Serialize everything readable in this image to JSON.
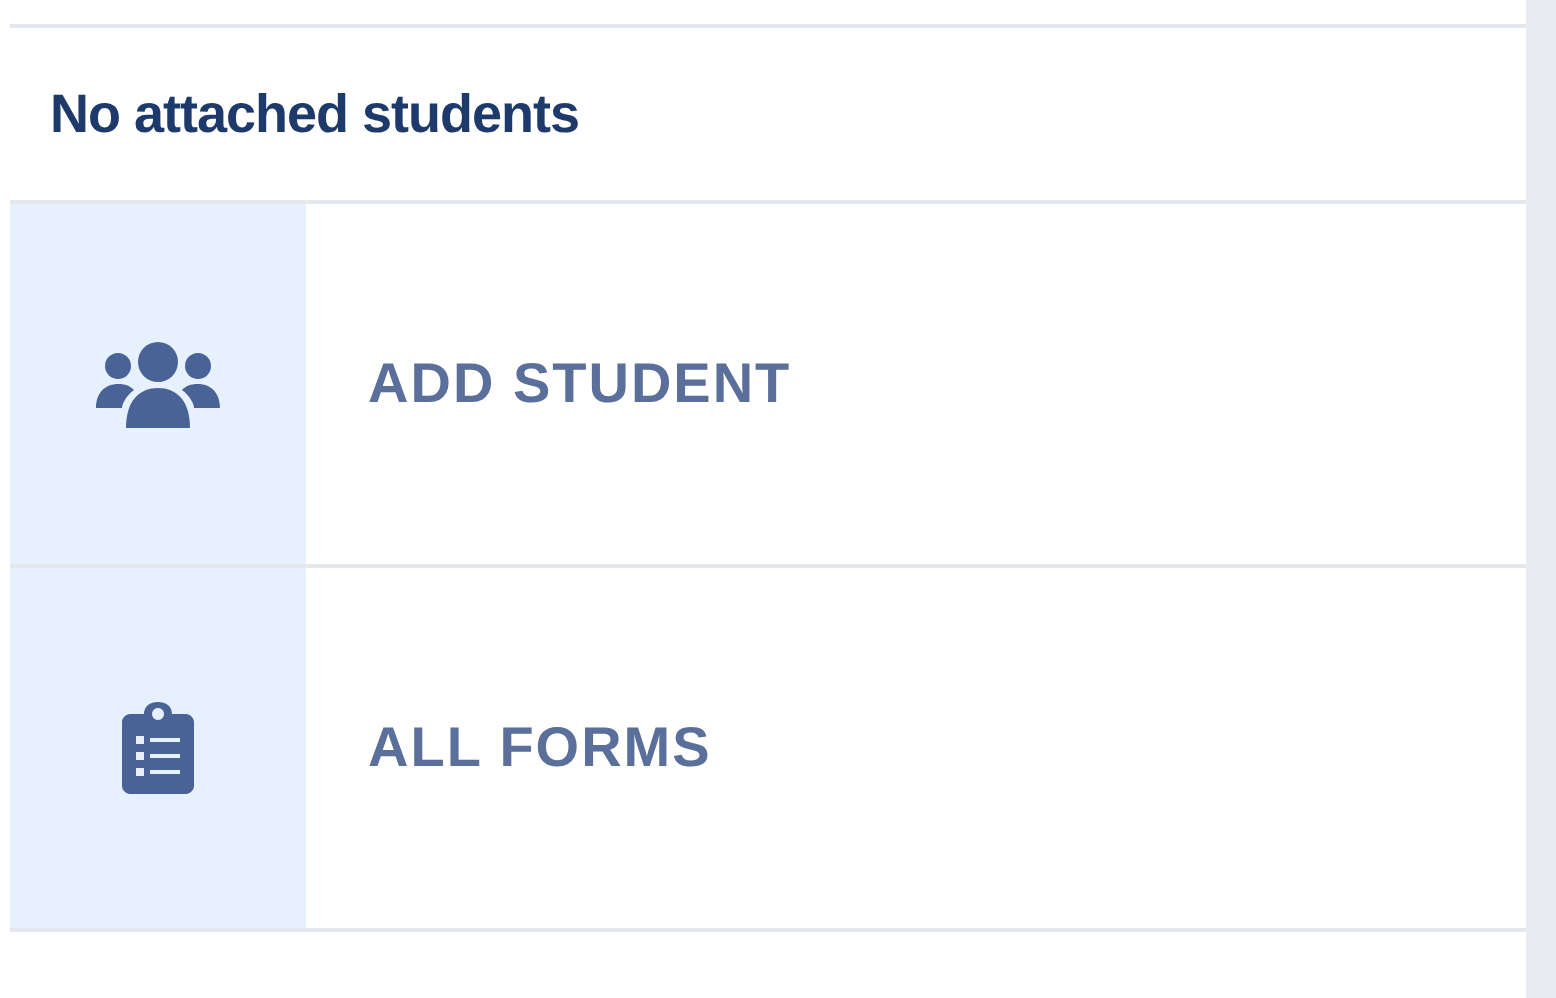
{
  "header": {
    "title": "No attached students"
  },
  "actions": [
    {
      "kind": "students",
      "label": "ADD STUDENT"
    },
    {
      "kind": "forms",
      "label": "ALL FORMS"
    }
  ]
}
